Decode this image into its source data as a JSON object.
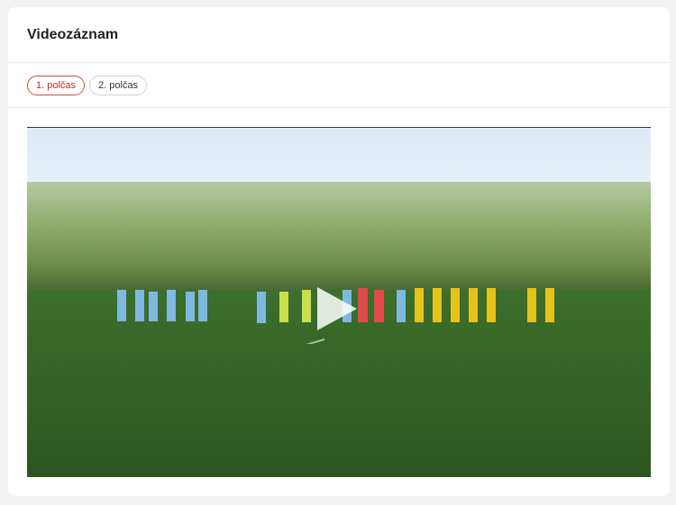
{
  "card": {
    "title": "Videozáznam"
  },
  "tabs": [
    {
      "label": "1. polčas",
      "active": true
    },
    {
      "label": "2. polčas",
      "active": false
    }
  ],
  "video": {
    "poster": "football-match-lineup"
  }
}
